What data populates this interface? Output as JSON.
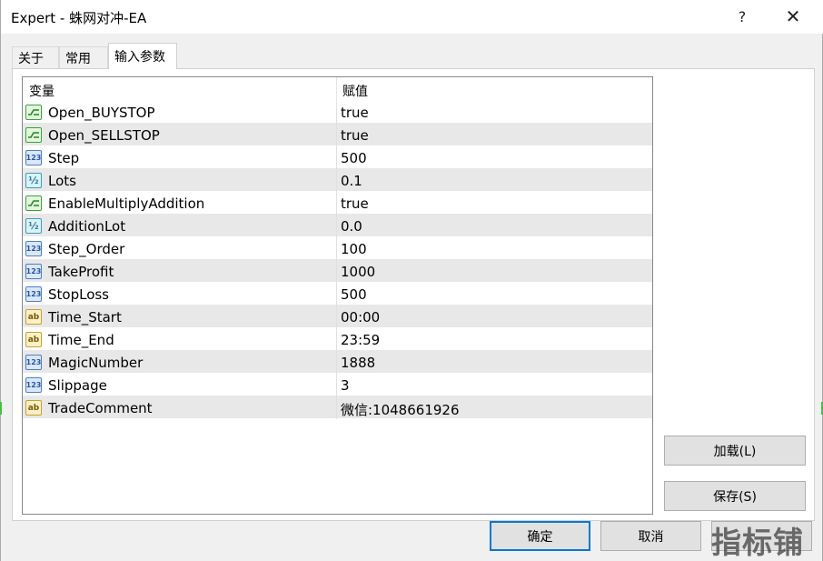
{
  "window": {
    "title": "Expert - 蛛网对冲-EA",
    "help_glyph": "?",
    "close_glyph": "✕"
  },
  "tabs": [
    {
      "label": "关于"
    },
    {
      "label": "常用"
    },
    {
      "label": "输入参数",
      "active": true
    }
  ],
  "table": {
    "headers": {
      "variable": "变量",
      "value": "赋值"
    },
    "rows": [
      {
        "type": "bool",
        "icon": "bool-type-icon",
        "name": "Open_BUYSTOP",
        "value": "true"
      },
      {
        "type": "bool",
        "icon": "bool-type-icon",
        "name": "Open_SELLSTOP",
        "value": "true"
      },
      {
        "type": "int",
        "icon": "int-type-icon",
        "name": "Step",
        "value": "500"
      },
      {
        "type": "double",
        "icon": "double-type-icon",
        "name": "Lots",
        "value": "0.1"
      },
      {
        "type": "bool",
        "icon": "bool-type-icon",
        "name": "EnableMultiplyAddition",
        "value": "true"
      },
      {
        "type": "double",
        "icon": "double-type-icon",
        "name": "AdditionLot",
        "value": "0.0"
      },
      {
        "type": "int",
        "icon": "int-type-icon",
        "name": "Step_Order",
        "value": "100"
      },
      {
        "type": "int",
        "icon": "int-type-icon",
        "name": "TakeProfit",
        "value": "1000"
      },
      {
        "type": "int",
        "icon": "int-type-icon",
        "name": "StopLoss",
        "value": "500"
      },
      {
        "type": "string",
        "icon": "string-type-icon",
        "name": "Time_Start",
        "value": "00:00"
      },
      {
        "type": "string",
        "icon": "string-type-icon",
        "name": "Time_End",
        "value": "23:59"
      },
      {
        "type": "int",
        "icon": "int-type-icon",
        "name": "MagicNumber",
        "value": "1888"
      },
      {
        "type": "int",
        "icon": "int-type-icon",
        "name": "Slippage",
        "value": "3"
      },
      {
        "type": "string",
        "icon": "string-type-icon",
        "name": "TradeComment",
        "value": "微信:1048661926"
      }
    ]
  },
  "icons": {
    "int_glyph": "123",
    "double_glyph": "½",
    "string_glyph": "ab"
  },
  "buttons": {
    "load": "加载(L)",
    "save": "保存(S)",
    "ok": "确定",
    "cancel": "取消"
  },
  "watermark": "指标铺",
  "colors": {
    "accent": "#0078d7",
    "bool_icon": "#3aa33a",
    "int_icon": "#4d7fc8",
    "double_icon": "#3b9fbd",
    "string_icon": "#c9a227"
  }
}
